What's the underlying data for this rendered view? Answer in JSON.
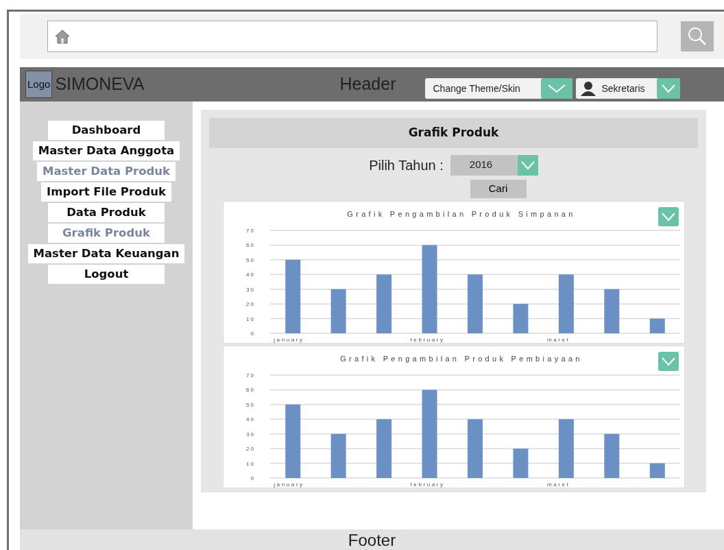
{
  "header": {
    "logo": "Logo",
    "app_name": "SIMONEVA",
    "title": "Header",
    "theme_select": "Change Theme/Skin",
    "user": "Sekretaris"
  },
  "sidebar": {
    "items": [
      {
        "label": "Dashboard",
        "selected": false
      },
      {
        "label": "Master Data Anggota",
        "selected": false
      },
      {
        "label": "Master Data Produk",
        "selected": true
      },
      {
        "label": "Import File Produk",
        "selected": false
      },
      {
        "label": "Data Produk",
        "selected": false
      },
      {
        "label": "Grafik Produk",
        "selected": true
      },
      {
        "label": "Master Data Keuangan",
        "selected": false
      },
      {
        "label": "Logout",
        "selected": false
      }
    ]
  },
  "main": {
    "title": "Grafik Produk",
    "year_label": "Pilih Tahun :",
    "year_select": "2016",
    "search_button": "Cari",
    "charts": [
      {
        "chart_data": {
          "type": "bar",
          "title": "Grafik Pengambilan Produk Simpanan",
          "categories": [
            "january",
            null,
            null,
            "february",
            null,
            null,
            "maret",
            null,
            null
          ],
          "ylim": [
            0,
            70
          ],
          "yticks": [
            0,
            10,
            20,
            30,
            40,
            50,
            60,
            70
          ],
          "grid": true,
          "series": [
            {
              "color": "#6b90c4",
              "values": [
                50,
                30,
                40,
                60,
                40,
                20,
                40,
                30,
                10
              ]
            }
          ]
        }
      },
      {
        "chart_data": {
          "type": "bar",
          "title": "Grafik Pengambilan Produk Pembiayaan",
          "categories": [
            "january",
            null,
            null,
            "february",
            null,
            null,
            "maret",
            null,
            null
          ],
          "ylim": [
            0,
            70
          ],
          "yticks": [
            0,
            10,
            20,
            30,
            40,
            50,
            60,
            70
          ],
          "grid": true,
          "series": [
            {
              "color": "#6b90c4",
              "values": [
                50,
                30,
                40,
                60,
                40,
                20,
                40,
                30,
                10
              ]
            }
          ]
        }
      }
    ]
  },
  "footer": {
    "text": "Footer"
  }
}
